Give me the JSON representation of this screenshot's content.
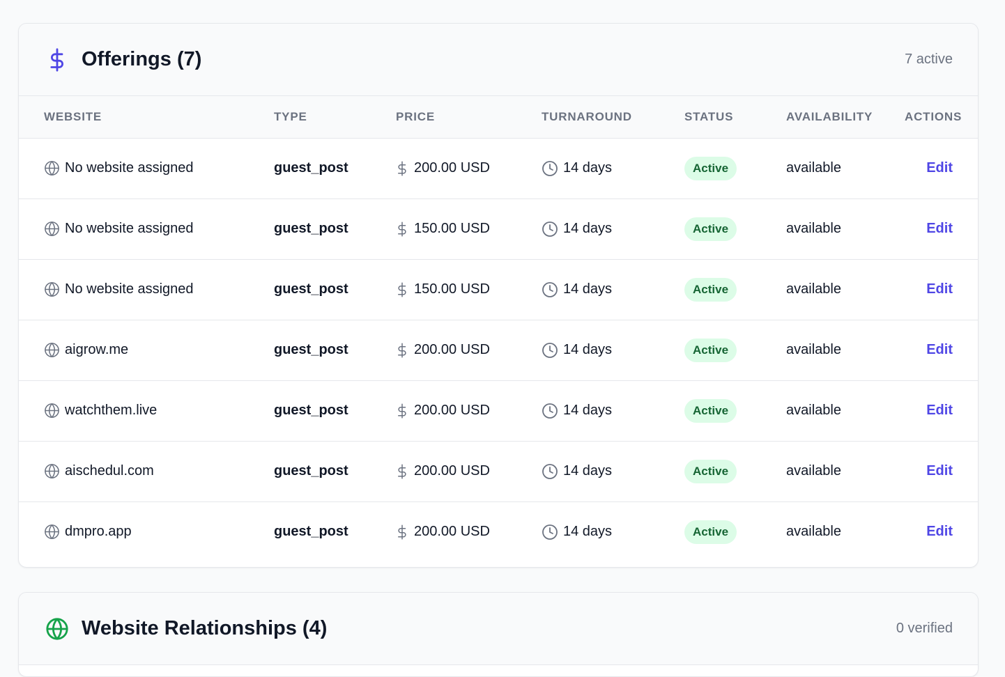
{
  "offerings": {
    "title": "Offerings (7)",
    "meta": "7 active",
    "icon_color": "#4f46e5",
    "columns": [
      "WEBSITE",
      "TYPE",
      "PRICE",
      "TURNAROUND",
      "STATUS",
      "AVAILABILITY",
      "ACTIONS"
    ],
    "rows": [
      {
        "website": "No website assigned",
        "type": "guest_post",
        "price": "200.00 USD",
        "turnaround": "14 days",
        "status": "Active",
        "availability": "available",
        "action": "Edit"
      },
      {
        "website": "No website assigned",
        "type": "guest_post",
        "price": "150.00 USD",
        "turnaround": "14 days",
        "status": "Active",
        "availability": "available",
        "action": "Edit"
      },
      {
        "website": "No website assigned",
        "type": "guest_post",
        "price": "150.00 USD",
        "turnaround": "14 days",
        "status": "Active",
        "availability": "available",
        "action": "Edit"
      },
      {
        "website": "aigrow.me",
        "type": "guest_post",
        "price": "200.00 USD",
        "turnaround": "14 days",
        "status": "Active",
        "availability": "available",
        "action": "Edit"
      },
      {
        "website": "watchthem.live",
        "type": "guest_post",
        "price": "200.00 USD",
        "turnaround": "14 days",
        "status": "Active",
        "availability": "available",
        "action": "Edit"
      },
      {
        "website": "aischedul.com",
        "type": "guest_post",
        "price": "200.00 USD",
        "turnaround": "14 days",
        "status": "Active",
        "availability": "available",
        "action": "Edit"
      },
      {
        "website": "dmpro.app",
        "type": "guest_post",
        "price": "200.00 USD",
        "turnaround": "14 days",
        "status": "Active",
        "availability": "available",
        "action": "Edit"
      }
    ]
  },
  "relationships": {
    "title": "Website Relationships (4)",
    "meta": "0 verified",
    "icon_color": "#16a34a"
  },
  "colors": {
    "accent": "#4f46e5",
    "badge_bg": "#dcfce7",
    "badge_text": "#166534",
    "muted": "#6b7280"
  }
}
